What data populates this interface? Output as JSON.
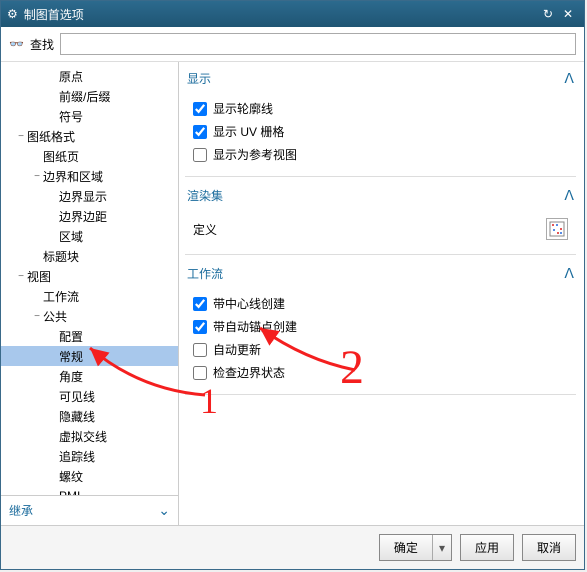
{
  "titlebar": {
    "title": "制图首选项",
    "reset_icon": "↻",
    "close_icon": "✕",
    "gear_icon": "⚙"
  },
  "search": {
    "icon": "👓",
    "label": "查找",
    "value": ""
  },
  "tree": [
    {
      "label": "原点",
      "depth": 3,
      "exp": ""
    },
    {
      "label": "前缀/后缀",
      "depth": 3,
      "exp": ""
    },
    {
      "label": "符号",
      "depth": 3,
      "exp": ""
    },
    {
      "label": "图纸格式",
      "depth": 1,
      "exp": "−"
    },
    {
      "label": "图纸页",
      "depth": 2,
      "exp": ""
    },
    {
      "label": "边界和区域",
      "depth": 2,
      "exp": "−"
    },
    {
      "label": "边界显示",
      "depth": 3,
      "exp": ""
    },
    {
      "label": "边界边距",
      "depth": 3,
      "exp": ""
    },
    {
      "label": "区域",
      "depth": 3,
      "exp": ""
    },
    {
      "label": "标题块",
      "depth": 2,
      "exp": ""
    },
    {
      "label": "视图",
      "depth": 1,
      "exp": "−"
    },
    {
      "label": "工作流",
      "depth": 2,
      "exp": ""
    },
    {
      "label": "公共",
      "depth": 2,
      "exp": "−"
    },
    {
      "label": "配置",
      "depth": 3,
      "exp": ""
    },
    {
      "label": "常规",
      "depth": 3,
      "exp": "",
      "selected": true
    },
    {
      "label": "角度",
      "depth": 3,
      "exp": ""
    },
    {
      "label": "可见线",
      "depth": 3,
      "exp": ""
    },
    {
      "label": "隐藏线",
      "depth": 3,
      "exp": ""
    },
    {
      "label": "虚拟交线",
      "depth": 3,
      "exp": ""
    },
    {
      "label": "追踪线",
      "depth": 3,
      "exp": ""
    },
    {
      "label": "螺纹",
      "depth": 3,
      "exp": ""
    },
    {
      "label": "PMI",
      "depth": 3,
      "exp": ""
    }
  ],
  "inherit": {
    "label": "继承",
    "chev": "⌄"
  },
  "sections": {
    "display": {
      "title": "显示",
      "rows": [
        {
          "label": "显示轮廓线",
          "checked": true
        },
        {
          "label": "显示 UV 栅格",
          "checked": true
        },
        {
          "label": "显示为参考视图",
          "checked": false
        }
      ]
    },
    "render": {
      "title": "渲染集",
      "def_label": "定义"
    },
    "workflow": {
      "title": "工作流",
      "rows": [
        {
          "label": "带中心线创建",
          "checked": true
        },
        {
          "label": "带自动锚点创建",
          "checked": true
        },
        {
          "label": "自动更新",
          "checked": false
        },
        {
          "label": "检查边界状态",
          "checked": false
        }
      ]
    }
  },
  "footer": {
    "ok": "确定",
    "apply": "应用",
    "cancel": "取消"
  },
  "annotations": {
    "one": "1",
    "two": "2"
  }
}
